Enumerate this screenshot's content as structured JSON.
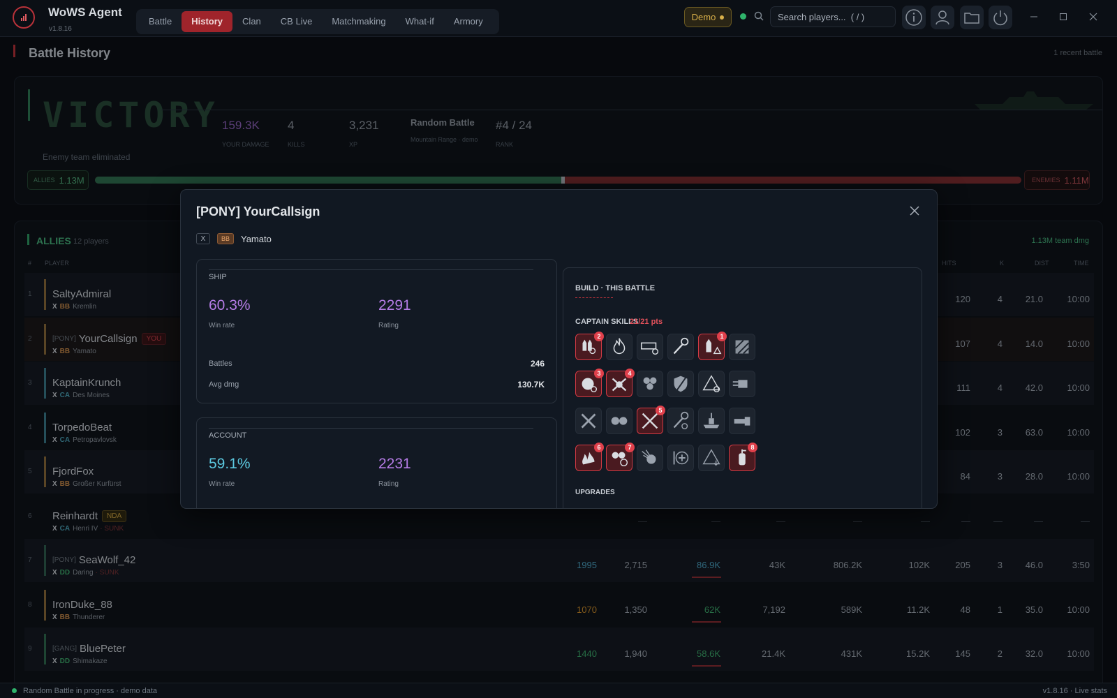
{
  "app": {
    "name": "WoWS Agent",
    "version": "v1.8.16"
  },
  "nav": {
    "tabs": [
      "Battle",
      "History",
      "Clan",
      "CB Live",
      "Matchmaking",
      "What-if",
      "Armory"
    ],
    "active": "History"
  },
  "header": {
    "demo_label": "Demo",
    "search_placeholder": "Search players...  ( / )"
  },
  "page": {
    "title": "Battle History",
    "recent": "1 recent battle"
  },
  "summary": {
    "result": "VICTORY",
    "subtitle": "Enemy team eliminated",
    "damage": "159.3K",
    "damage_label": "YOUR DAMAGE",
    "kills": "4",
    "kills_label": "KILLS",
    "xp": "3,231",
    "xp_label": "XP",
    "mode": "Random Battle",
    "map": "Mountain Range · demo",
    "rank": "#4 / 24",
    "rank_label": "RANK",
    "allies_label": "ALLIES",
    "allies_dmg": "1.13M",
    "enemies_label": "ENEMIES",
    "enemies_dmg": "1.11M",
    "allies_share": 0.505
  },
  "roster": {
    "title": "ALLIES",
    "count": "12 players",
    "team_dmg": "1.13M team dmg",
    "columns": {
      "idx": "#",
      "player": "PLAYER",
      "hits": "HITS",
      "kills": "K",
      "dist": "DIST",
      "time": "TIME"
    },
    "rows": [
      {
        "idx": "1",
        "clan": "",
        "name": "SaltyAdmiral",
        "tag": "",
        "tier": "X",
        "cls": "BB",
        "ship": "Kremlin",
        "sunk": "",
        "pr": "",
        "dmg2": "",
        "dmg": "",
        "c4": "",
        "c5": "",
        "c6": "",
        "hits": "120",
        "k": "4",
        "dist": "21.0",
        "time": "10:00"
      },
      {
        "idx": "2",
        "clan": "[PONY]",
        "name": "YourCallsign",
        "tag": "YOU",
        "tier": "X",
        "cls": "BB",
        "ship": "Yamato",
        "sunk": "",
        "pr": "",
        "dmg2": "",
        "dmg": "",
        "c4": "",
        "c5": "",
        "c6": "",
        "hits": "107",
        "k": "4",
        "dist": "14.0",
        "time": "10:00"
      },
      {
        "idx": "3",
        "clan": "",
        "name": "KaptainKrunch",
        "tag": "",
        "tier": "X",
        "cls": "CA",
        "ship": "Des Moines",
        "sunk": "",
        "pr": "",
        "dmg2": "",
        "dmg": "",
        "c4": "",
        "c5": "",
        "c6": "",
        "hits": "111",
        "k": "4",
        "dist": "42.0",
        "time": "10:00"
      },
      {
        "idx": "4",
        "clan": "",
        "name": "TorpedoBeat",
        "tag": "",
        "tier": "X",
        "cls": "CA",
        "ship": "Petropavlovsk",
        "sunk": "",
        "pr": "",
        "dmg2": "",
        "dmg": "",
        "c4": "",
        "c5": "",
        "c6": "",
        "hits": "102",
        "k": "3",
        "dist": "63.0",
        "time": "10:00"
      },
      {
        "idx": "5",
        "clan": "",
        "name": "FjordFox",
        "tag": "",
        "tier": "X",
        "cls": "BB",
        "ship": "Großer Kurfürst",
        "sunk": "",
        "pr": "",
        "dmg2": "",
        "dmg": "",
        "c4": "",
        "c5": "",
        "c6": "",
        "hits": "84",
        "k": "3",
        "dist": "28.0",
        "time": "10:00"
      },
      {
        "idx": "6",
        "clan": "",
        "name": "Reinhardt",
        "tag": "NDA",
        "tier": "X",
        "cls": "CA",
        "ship": "Henri IV",
        "sunk": "· SUNK",
        "pr": "",
        "dmg2": "—",
        "dmg": "—",
        "c4": "—",
        "c5": "—",
        "c6": "—",
        "hits": "—",
        "k": "—",
        "dist": "—",
        "time": "—"
      },
      {
        "idx": "7",
        "clan": "[PONY]",
        "name": "SeaWolf_42",
        "tag": "",
        "tier": "X",
        "cls": "DD",
        "ship": "Daring",
        "sunk": "· SUNK",
        "pr": "1995",
        "dmg2": "2,715",
        "dmg": "86.9K",
        "c4": "43K",
        "c5": "806.2K",
        "c6": "102K",
        "hits": "205",
        "k": "3",
        "dist": "46.0",
        "time": "3:50"
      },
      {
        "idx": "8",
        "clan": "",
        "name": "IronDuke_88",
        "tag": "",
        "tier": "X",
        "cls": "BB",
        "ship": "Thunderer",
        "sunk": "",
        "pr": "1070",
        "dmg2": "1,350",
        "dmg": "62K",
        "c4": "7,192",
        "c5": "589K",
        "c6": "11.2K",
        "hits": "48",
        "k": "1",
        "dist": "35.0",
        "time": "10:00"
      },
      {
        "idx": "9",
        "clan": "[GANG]",
        "name": "BluePeter",
        "tag": "",
        "tier": "X",
        "cls": "DD",
        "ship": "Shimakaze",
        "sunk": "",
        "pr": "1440",
        "dmg2": "1,940",
        "dmg": "58.6K",
        "c4": "21.4K",
        "c5": "431K",
        "c6": "15.2K",
        "hits": "145",
        "k": "2",
        "dist": "32.0",
        "time": "10:00"
      }
    ]
  },
  "statusbar": {
    "left": "Random Battle in progress · demo data",
    "right": "v1.8.16  ·  Live stats"
  },
  "modal": {
    "title": "[PONY] YourCallsign",
    "tier": "X",
    "cls": "BB",
    "ship": "Yamato",
    "ship_panel": {
      "title": "SHIP",
      "winrate": "60.3%",
      "winrate_label": "Win rate",
      "rating": "2291",
      "rating_label": "Rating",
      "battles_label": "Battles",
      "battles": "246",
      "avgdmg_label": "Avg dmg",
      "avgdmg": "130.7K"
    },
    "account_panel": {
      "title": "ACCOUNT",
      "winrate": "59.1%",
      "winrate_label": "Win rate",
      "rating": "2231",
      "rating_label": "Rating"
    },
    "build": {
      "title": "BUILD · THIS BATTLE",
      "skills_label": "CAPTAIN SKILLS",
      "skills_points": "21/21 pts",
      "upgrades_label": "UPGRADES",
      "skills": [
        {
          "icon": "shell-reload-icon",
          "rank": "2"
        },
        {
          "icon": "fire-icon",
          "rank": ""
        },
        {
          "icon": "gun-reload-icon",
          "rank": ""
        },
        {
          "icon": "wrench-repair-icon",
          "rank": ""
        },
        {
          "icon": "shell-warning-icon",
          "rank": "1"
        },
        {
          "icon": "camo-icon",
          "rank": ""
        },
        {
          "icon": "detonation-reload-icon",
          "rank": "3"
        },
        {
          "icon": "aa-crossed-icon",
          "rank": "4"
        },
        {
          "icon": "fan-icon",
          "rank": ""
        },
        {
          "icon": "shield-icon",
          "rank": ""
        },
        {
          "icon": "warning-target-icon",
          "rank": ""
        },
        {
          "icon": "gun-turret-icon",
          "rank": ""
        },
        {
          "icon": "plane-crossed-icon",
          "rank": ""
        },
        {
          "icon": "bombs-icon",
          "rank": ""
        },
        {
          "icon": "crossed-swords-icon",
          "rank": "5"
        },
        {
          "icon": "wrench-reload-icon",
          "rank": ""
        },
        {
          "icon": "ship-upgrade-icon",
          "rank": ""
        },
        {
          "icon": "chainsaw-icon",
          "rank": ""
        },
        {
          "icon": "fire-spread-icon",
          "rank": "6"
        },
        {
          "icon": "bomb-target-icon",
          "rank": "7"
        },
        {
          "icon": "meteor-icon",
          "rank": ""
        },
        {
          "icon": "heal-icon",
          "rank": ""
        },
        {
          "icon": "warning-down-icon",
          "rank": ""
        },
        {
          "icon": "extinguisher-icon",
          "rank": "8"
        }
      ]
    }
  }
}
